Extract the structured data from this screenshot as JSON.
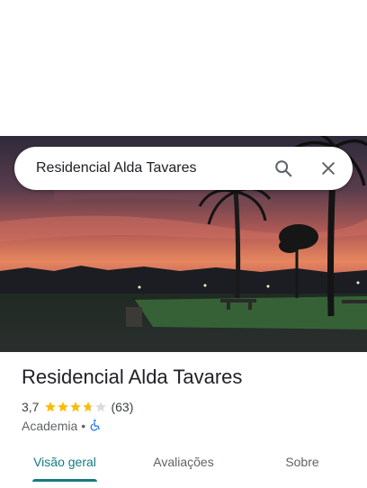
{
  "search": {
    "query": "Residencial Alda Tavares",
    "search_icon": "search-icon",
    "close_icon": "close-icon"
  },
  "place": {
    "name": "Residencial Alda Tavares",
    "rating": "3,7",
    "rating_value": 3.7,
    "review_count": "(63)",
    "category": "Academia",
    "separator": "•",
    "accessibility_icon": "wheelchair-accessible-icon"
  },
  "tabs": [
    {
      "label": "Visão geral",
      "active": true
    },
    {
      "label": "Avaliações",
      "active": false
    },
    {
      "label": "Sobre",
      "active": false
    }
  ],
  "colors": {
    "accent": "#137b82",
    "star": "#fbbc04",
    "star_empty": "#dadce0",
    "accessibility": "#1a73e8"
  }
}
